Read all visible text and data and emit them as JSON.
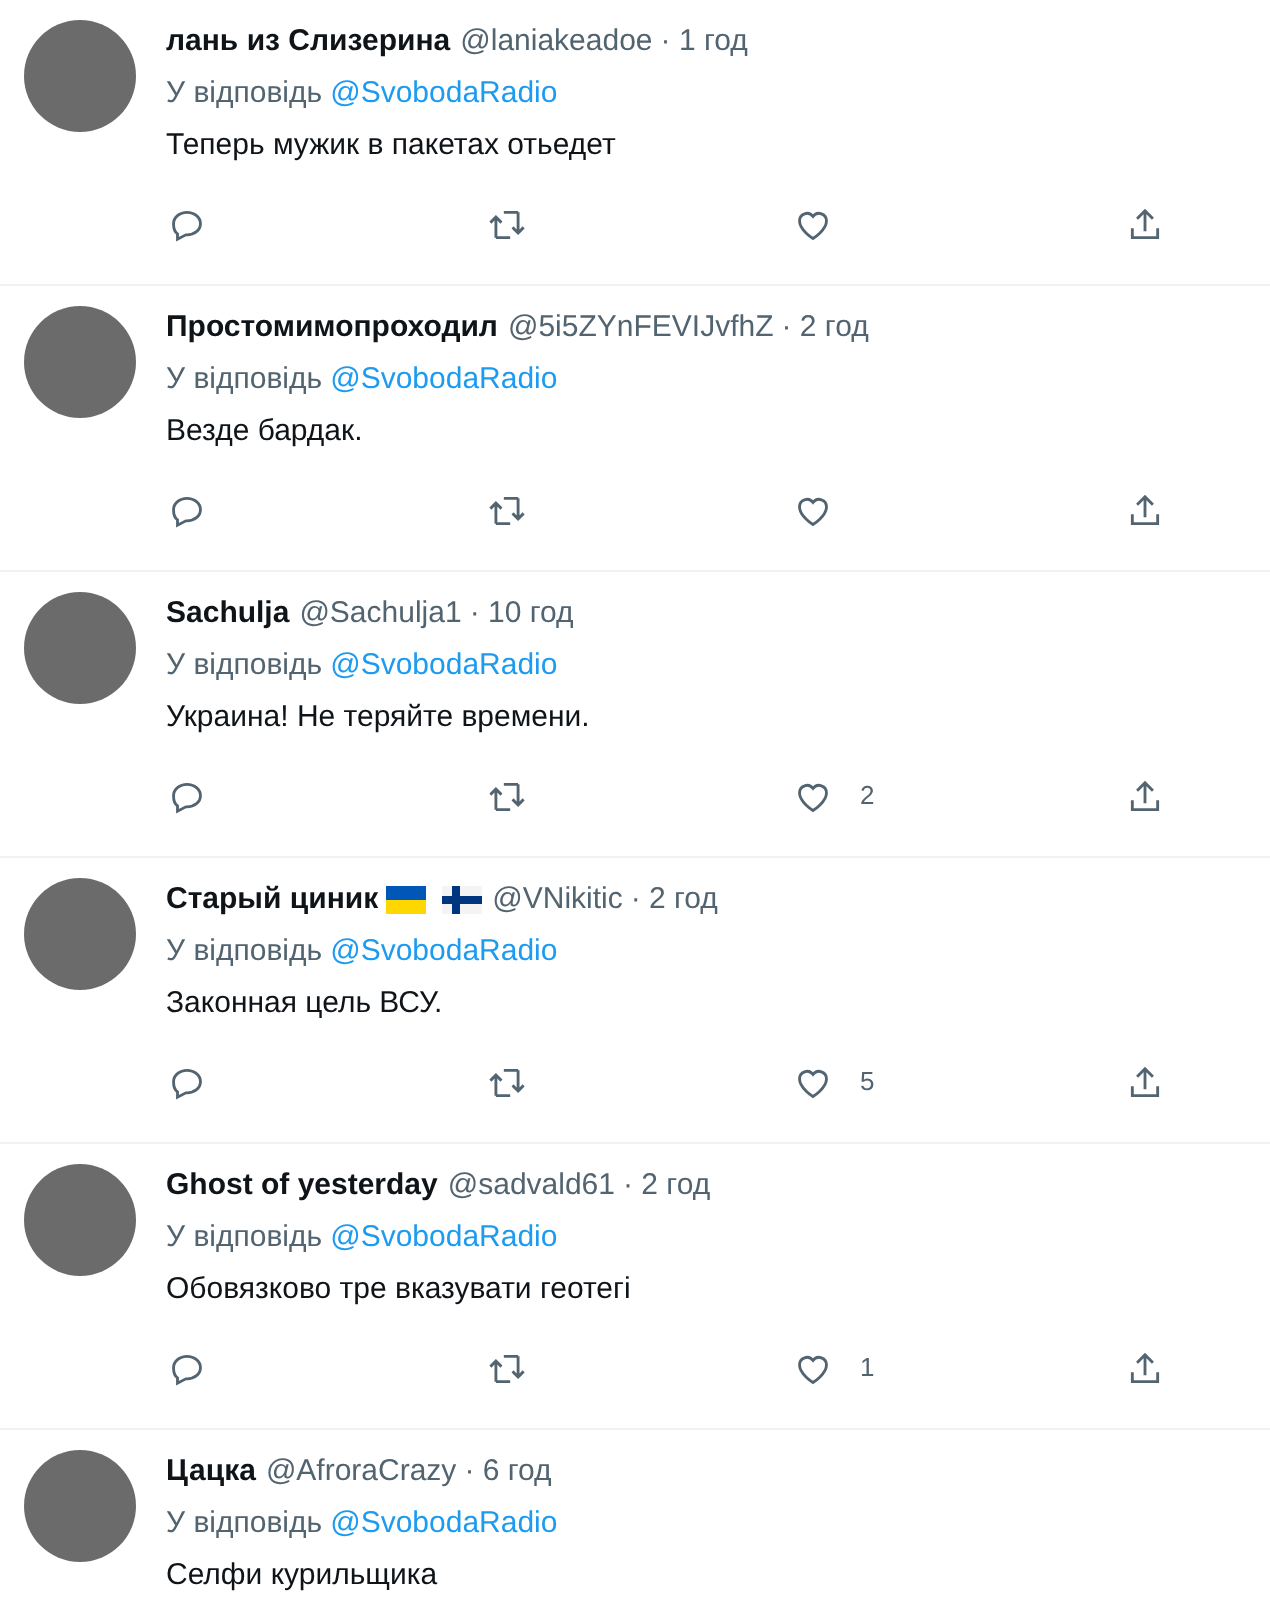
{
  "tweets": [
    {
      "name": "лань из Слизерина",
      "handle": "@laniakeadoe",
      "time": "· 1 год",
      "reply_prefix": "У відповідь",
      "reply_to": "@SvobodaRadio",
      "text": "Теперь мужик в пакетах отьедет"
    },
    {
      "name": "Простомимопроходил",
      "handle": "@5i5ZYnFEVIJvfhZ",
      "time": "· 2 год",
      "reply_prefix": "У відповідь",
      "reply_to": "@SvobodaRadio",
      "text": "Везде бардак."
    },
    {
      "name": "Sachulja",
      "handle": "@Sachulja1",
      "time": "· 10 год",
      "reply_prefix": "У відповідь",
      "reply_to": "@SvobodaRadio",
      "text": "Украина! Не теряйте времени.",
      "likes": "2"
    },
    {
      "name": "Старый циник",
      "flags": [
        {
          "kind": "ukraine"
        },
        {
          "kind": "finland"
        }
      ],
      "handle": "@VNikitic",
      "time": "· 2 год",
      "reply_prefix": "У відповідь",
      "reply_to": "@SvobodaRadio",
      "text": "Законная цель ВСУ.",
      "likes": "5"
    },
    {
      "name": "Ghost of yesterday",
      "handle": "@sadvald61",
      "time": "· 2 год",
      "reply_prefix": "У відповідь",
      "reply_to": "@SvobodaRadio",
      "text": "Обовязково тре вказувати геотегі",
      "likes": "1"
    },
    {
      "name": "Цацка",
      "handle": "@AfroraCrazy",
      "time": "· 6 год",
      "reply_prefix": "У відповідь",
      "reply_to": "@SvobodaRadio",
      "text": "Селфи курильщика"
    }
  ]
}
